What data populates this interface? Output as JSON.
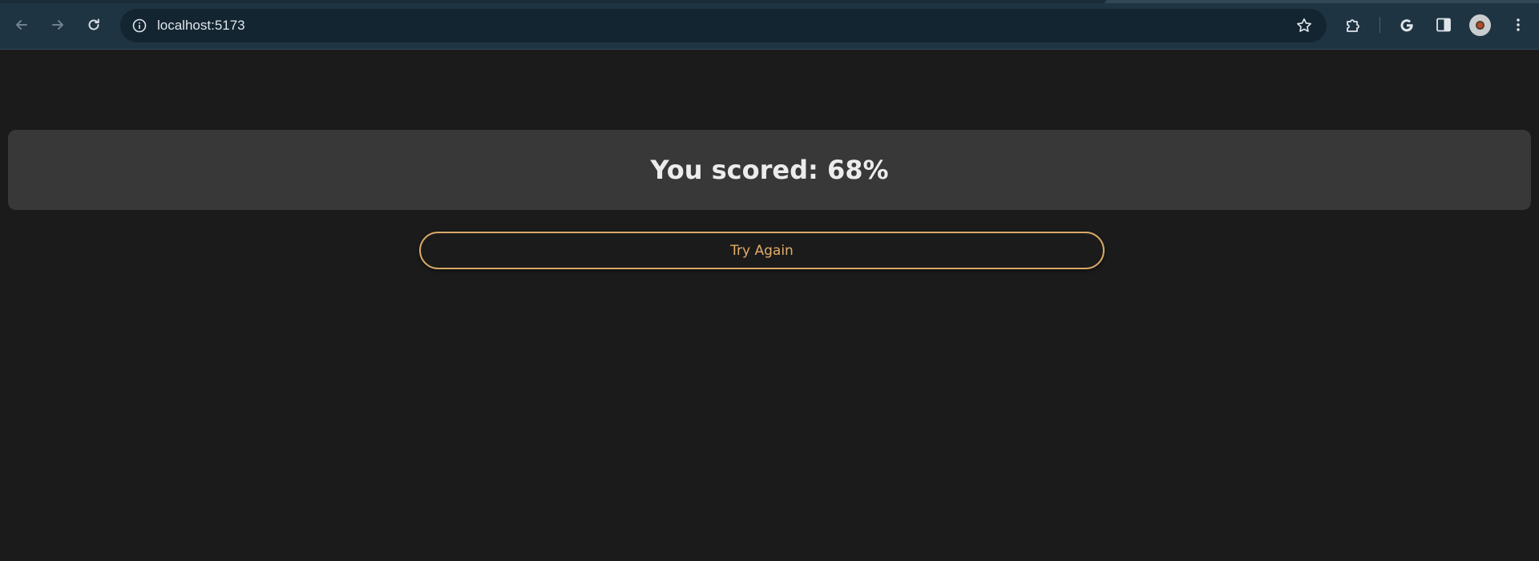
{
  "browser": {
    "url": "localhost:5173",
    "icons": {
      "back": "arrow-left-icon",
      "forward": "arrow-right-icon",
      "reload": "reload-icon",
      "site_info": "info-icon",
      "bookmark": "star-icon",
      "extensions": "puzzle-icon",
      "google": "google-icon",
      "side_panel": "side-panel-icon",
      "profile": "avatar",
      "menu": "kebab-menu-icon"
    }
  },
  "main": {
    "score_text": "You scored: 68%",
    "try_again_label": "Try Again"
  },
  "colors": {
    "page_bg": "#1b1b1b",
    "panel_bg": "#383838",
    "accent": "#d9a965",
    "chrome_bg": "#1f3443"
  }
}
